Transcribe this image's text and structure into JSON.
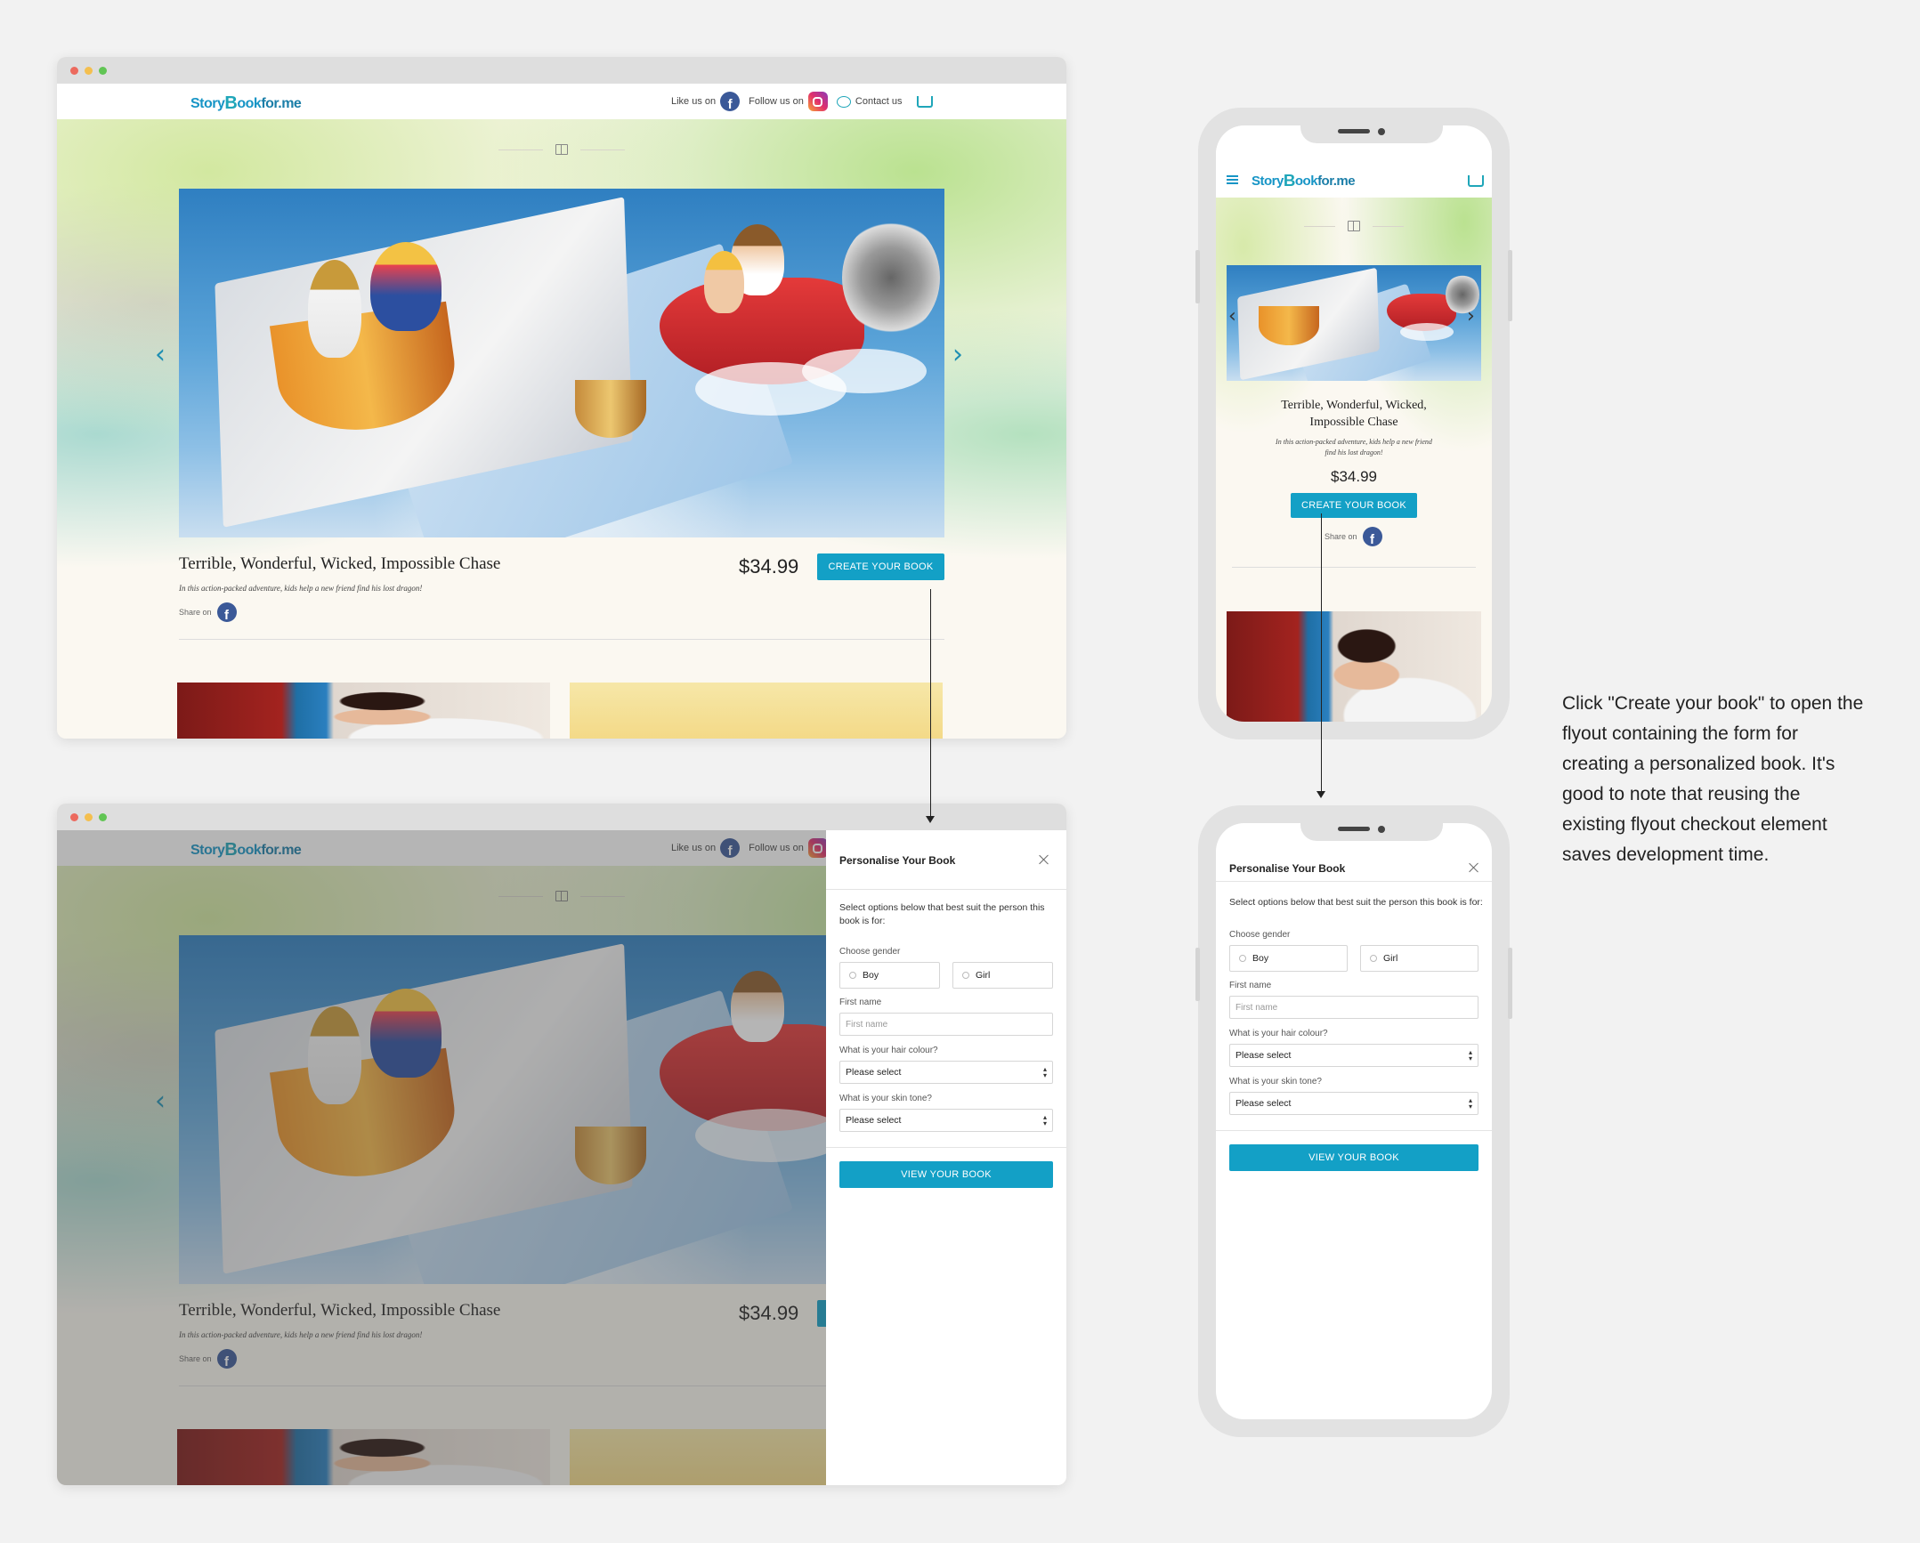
{
  "brand": {
    "logo_story": "Story",
    "logo_b": "B",
    "logo_ook": "ook",
    "logo_forme": "for.me"
  },
  "header": {
    "like_label": "Like us on",
    "follow_label": "Follow us on",
    "contact_label": "Contact us",
    "fb_glyph": "f"
  },
  "product": {
    "title": "Terrible, Wonderful, Wicked, Impossible Chase",
    "title_mobile_line1": "Terrible, Wonderful, Wicked,",
    "title_mobile_line2": "Impossible Chase",
    "description": "In this action-packed adventure, kids help a new friend find his lost dragon!",
    "description_mobile_line1": "In this action-packed adventure, kids help a new friend",
    "description_mobile_line2": "find his lost dragon!",
    "price": "$34.99",
    "cta": "CREATE YOUR BOOK",
    "share_label": "Share on"
  },
  "carousel": {
    "prev_glyph": "‹",
    "next_glyph": "›"
  },
  "flyout": {
    "title": "Personalise Your Book",
    "intro": "Select options below that best suit the person this book is for:",
    "gender_label": "Choose gender",
    "gender_options": [
      "Boy",
      "Girl"
    ],
    "first_name_label": "First name",
    "first_name_placeholder": "First name",
    "hair_label": "What is your hair colour?",
    "hair_value": "Please select",
    "skin_label": "What is your skin tone?",
    "skin_value": "Please select",
    "submit": "VIEW YOUR BOOK"
  },
  "annotation": "Click \"Create your book\" to open the flyout containing the form for creating a personalized book. It's good to note that reusing the existing flyout checkout element saves development time.",
  "colors": {
    "accent": "#13a0c6",
    "brand": "#1795c6",
    "facebook": "#3b5998"
  }
}
